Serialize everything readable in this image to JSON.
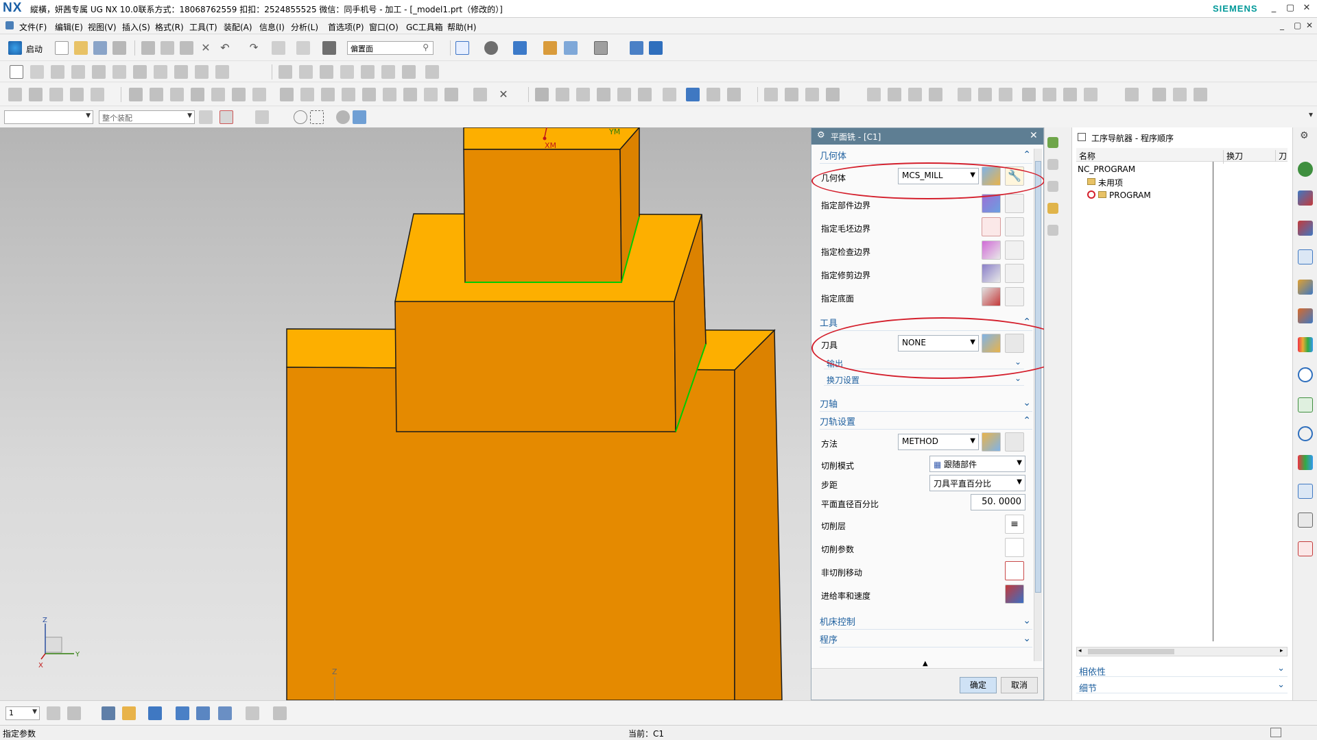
{
  "window": {
    "logo": "NX",
    "title": "縱橫，妍茜专属 UG NX 10.0联系方式：18068762559 扣扣：2524855525 微信：同手机号 - 加工 - [_model1.prt（修改的）]",
    "brand": "SIEMENS",
    "controls": [
      "_",
      "▢",
      "✕"
    ]
  },
  "menu": [
    "文件(F)",
    "编辑(E)",
    "视图(V)",
    "插入(S)",
    "格式(R)",
    "工具(T)",
    "装配(A)",
    "信息(I)",
    "分析(L)",
    "首选项(P)",
    "窗口(O)",
    "GC工具箱",
    "帮助(H)"
  ],
  "toolbar": {
    "start_label": "启动",
    "view_combo": "偏置面",
    "filter_combo": "",
    "assembly_combo": "整个装配"
  },
  "viewport": {
    "axis_labels": {
      "xm": "XM",
      "ym": "YM",
      "z_bottom": "Z",
      "triad_z": "Z",
      "triad_y": "Y",
      "triad_x": "X"
    },
    "colors": {
      "top_face": "#fdaf00",
      "side_face": "#e58a00",
      "edge": "#1a1a1a",
      "highlight": "#00cc00"
    }
  },
  "dialog": {
    "title": "平面铣 - [C1]",
    "sections": {
      "geometry": {
        "title": "几何体",
        "geometry_label": "几何体",
        "geometry_value": "MCS_MILL",
        "rows": [
          "指定部件边界",
          "指定毛坯边界",
          "指定检查边界",
          "指定修剪边界",
          "指定底面"
        ]
      },
      "tool": {
        "title": "工具",
        "tool_label": "刀具",
        "tool_value": "NONE",
        "output": "输出",
        "tool_change": "换刀设置"
      },
      "axis": {
        "title": "刀轴"
      },
      "path": {
        "title": "刀轨设置",
        "method_label": "方法",
        "method_value": "METHOD",
        "cut_mode_label": "切削模式",
        "cut_mode_value": "跟随部件",
        "stepover_label": "步距",
        "stepover_value": "刀具平直百分比",
        "flat_pct_label": "平面直径百分比",
        "flat_pct_value": "50. 0000",
        "cut_levels": "切削层",
        "cut_params": "切削参数",
        "non_cut": "非切削移动",
        "feeds": "进给率和速度"
      },
      "machine": {
        "title": "机床控制"
      },
      "program": {
        "title": "程序"
      }
    },
    "ok": "确定",
    "cancel": "取消"
  },
  "navigator": {
    "title": "工序导航器 - 程序顺序",
    "columns": [
      "名称",
      "换刀",
      "刀"
    ],
    "tree": [
      "NC_PROGRAM",
      "未用项",
      "PROGRAM"
    ],
    "relations": "相依性",
    "details": "细节"
  },
  "bottom": {
    "layer_value": "1"
  },
  "status": {
    "prompt": "指定参数",
    "current": "当前：C1"
  }
}
